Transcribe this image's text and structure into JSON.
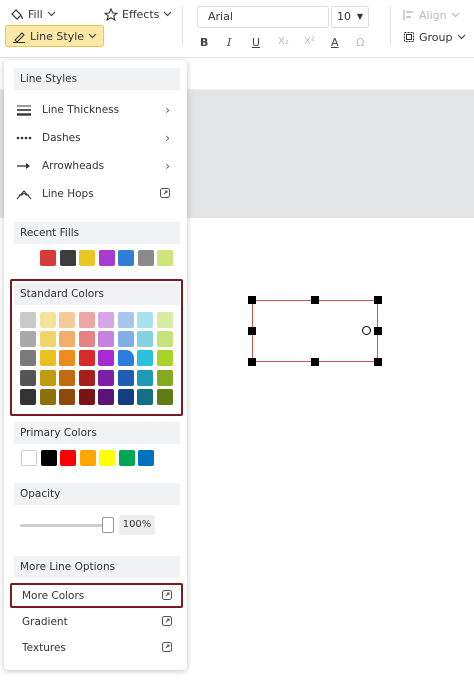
{
  "toolbar": {
    "fill_label": "Fill",
    "effects_label": "Effects",
    "line_style_label": "Line Style",
    "font_family": "Arial",
    "font_size": "10",
    "align_label": "Align",
    "group_label": "Group"
  },
  "panel": {
    "line_styles_header": "Line Styles",
    "line_items": [
      {
        "label": "Line Thickness"
      },
      {
        "label": "Dashes"
      },
      {
        "label": "Arrowheads"
      },
      {
        "label": "Line Hops"
      }
    ],
    "recent_fills_header": "Recent Fills",
    "recent_fills": [
      "#d63a3a",
      "#3d3d3d",
      "#e9c823",
      "#a83ad0",
      "#2f7fd6",
      "#8a8a8a",
      "#cde67a"
    ],
    "standard_colors_header": "Standard Colors",
    "standard_colors": [
      [
        "#c9c9c9",
        "#f6e39a",
        "#f6c89a",
        "#eda6a6",
        "#d6a6e6",
        "#a6c6ee",
        "#a6e2ee",
        "#d6ec9e"
      ],
      [
        "#a9a9a9",
        "#f2d36a",
        "#f2ad6a",
        "#e68282",
        "#c682de",
        "#82aee6",
        "#82d2e6",
        "#c6e27a"
      ],
      [
        "#7a7a7a",
        "#e9c01e",
        "#f08a1e",
        "#d62a2a",
        "#aa2ad2",
        "#2a7ee0",
        "#2ac0de",
        "#a9d22a"
      ],
      [
        "#555555",
        "#c29a0e",
        "#c26a0e",
        "#a81e1e",
        "#7e1ea6",
        "#1e5eb4",
        "#1e9ab4",
        "#86aa1e"
      ],
      [
        "#333333",
        "#8e700a",
        "#8e4a0a",
        "#7a1414",
        "#5a1478",
        "#143e84",
        "#147084",
        "#607a14"
      ]
    ],
    "primary_colors_header": "Primary Colors",
    "primary_colors": [
      "#ffffff",
      "#000000",
      "#ff0000",
      "#ffa500",
      "#ffff00",
      "#00a651",
      "#0070c0"
    ],
    "opacity_header": "Opacity",
    "opacity_value": "100%",
    "opacity_fraction": 1.0,
    "more_line_options_header": "More Line Options",
    "options": [
      {
        "label": "More Colors"
      },
      {
        "label": "Gradient"
      },
      {
        "label": "Textures"
      }
    ],
    "highlight_color": "#7b1a25"
  }
}
